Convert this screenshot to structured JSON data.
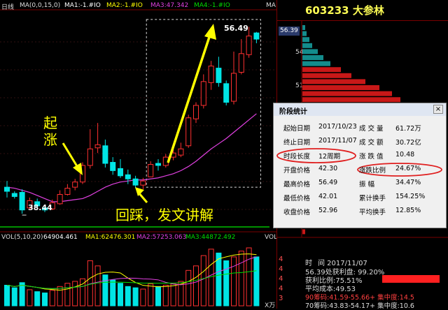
{
  "header": {
    "period": "日线",
    "ma_text": "MA(0,0,15,0)",
    "ma1": "MA1:-1.#IO",
    "ma2": "MA2:-1.#IO",
    "ma3": "MA3:47.342",
    "ma4": "MA4:-1.#IO",
    "corner": "MA"
  },
  "price_annotations": {
    "high": "56.49",
    "low": "38.44"
  },
  "annotations": {
    "qi": "起",
    "zhang": "涨",
    "huicai": "回踩，发文讲解"
  },
  "volume_header": {
    "vol": "VOL(5,10,20)",
    "vol_value": "64904.461",
    "ma1": "MA1:62476.301",
    "ma2": "MA2:57253.063",
    "ma3": "MA3:44872.492",
    "corner": "VOL",
    "unit": "X万"
  },
  "right_panel": {
    "stock_title": "603233  大参林",
    "price_box": "56.39",
    "y_labels": [
      "54",
      "51"
    ]
  },
  "dialog": {
    "title": "阶段统计",
    "close": "×",
    "rows": [
      {
        "k1": "起始日期",
        "v1": "2017/10/23",
        "k2": "成 交 量",
        "v2": "61.72万"
      },
      {
        "k1": "终止日期",
        "v1": "2017/11/07",
        "k2": "成 交 额",
        "v2": "30.72亿"
      },
      {
        "k1": "时段长度",
        "v1": "12周期",
        "k2": "涨 跌 值",
        "v2": "10.48"
      },
      {
        "k1": "开盘价格",
        "v1": "42.30",
        "k2": "涨跌比例",
        "v2": "24.67%"
      },
      {
        "k1": "最高价格",
        "v1": "56.49",
        "k2": "振    幅",
        "v2": "34.47%"
      },
      {
        "k1": "最低价格",
        "v1": "42.01",
        "k2": "累计换手",
        "v2": "154.25%"
      },
      {
        "k1": "收盘价格",
        "v1": "52.96",
        "k2": "平均换手",
        "v2": "12.85%"
      }
    ]
  },
  "info_panel": {
    "time_label": "时",
    "time_value": "间  2017/11/07",
    "line1": "56.39处获利盘: 99.20%",
    "line2": "获利比例:75.51%",
    "line3": "平均成本:49.53",
    "line4": "90筹码:41.59-55.66+ 集中度:14.5",
    "line5": "70筹码:43.83-54.17+ 集中度:10.6",
    "side_labels": [
      "4",
      "4",
      "4",
      "4",
      "3"
    ]
  },
  "colors": {
    "up": "#ff3030",
    "down": "#00e5e5",
    "ma": "#e040e0",
    "annotation": "#ffff00",
    "grid": "#7a0000"
  },
  "chart_data": {
    "type": "candlestick",
    "candles": [
      {
        "o": 41.0,
        "c": 40.6,
        "h": 41.6,
        "l": 40.0
      },
      {
        "o": 40.4,
        "c": 40.1,
        "h": 40.6,
        "l": 39.9
      },
      {
        "o": 40.5,
        "c": 38.8,
        "h": 40.8,
        "l": 38.44
      },
      {
        "o": 39.0,
        "c": 39.7,
        "h": 40.0,
        "l": 38.9
      },
      {
        "o": 39.6,
        "c": 39.2,
        "h": 39.9,
        "l": 39.0
      },
      {
        "o": 39.0,
        "c": 38.8,
        "h": 39.3,
        "l": 38.6
      },
      {
        "o": 38.9,
        "c": 39.5,
        "h": 39.8,
        "l": 38.8
      },
      {
        "o": 39.4,
        "c": 40.3,
        "h": 40.7,
        "l": 39.3
      },
      {
        "o": 40.3,
        "c": 40.9,
        "h": 41.3,
        "l": 40.2
      },
      {
        "o": 41.0,
        "c": 41.5,
        "h": 41.8,
        "l": 40.7
      },
      {
        "o": 41.5,
        "c": 43.1,
        "h": 43.4,
        "l": 41.3
      },
      {
        "o": 43.1,
        "c": 44.7,
        "h": 46.6,
        "l": 42.8
      },
      {
        "o": 44.8,
        "c": 45.1,
        "h": 47.2,
        "l": 44.3
      },
      {
        "o": 45.0,
        "c": 43.3,
        "h": 45.6,
        "l": 42.9
      },
      {
        "o": 43.4,
        "c": 42.6,
        "h": 43.9,
        "l": 42.2
      },
      {
        "o": 42.8,
        "c": 42.1,
        "h": 43.7,
        "l": 41.9
      },
      {
        "o": 42.2,
        "c": 41.8,
        "h": 42.7,
        "l": 41.3
      },
      {
        "o": 41.8,
        "c": 41.2,
        "h": 42.1,
        "l": 40.9
      },
      {
        "o": 41.2,
        "c": 41.6,
        "h": 41.9,
        "l": 40.8
      },
      {
        "o": 42.0,
        "c": 43.2,
        "h": 43.5,
        "l": 42.0
      },
      {
        "o": 43.3,
        "c": 43.1,
        "h": 43.7,
        "l": 42.6
      },
      {
        "o": 43.1,
        "c": 43.9,
        "h": 44.2,
        "l": 42.9
      },
      {
        "o": 43.9,
        "c": 44.3,
        "h": 45.0,
        "l": 43.6
      },
      {
        "o": 44.1,
        "c": 44.7,
        "h": 45.3,
        "l": 43.9
      },
      {
        "o": 45.0,
        "c": 47.7,
        "h": 48.0,
        "l": 44.8
      },
      {
        "o": 47.6,
        "c": 48.9,
        "h": 49.2,
        "l": 47.2
      },
      {
        "o": 48.9,
        "c": 51.2,
        "h": 51.9,
        "l": 48.6
      },
      {
        "o": 51.1,
        "c": 52.7,
        "h": 53.2,
        "l": 50.4
      },
      {
        "o": 52.5,
        "c": 51.1,
        "h": 53.6,
        "l": 50.7
      },
      {
        "o": 51.0,
        "c": 49.2,
        "h": 51.3,
        "l": 48.9
      },
      {
        "o": 49.3,
        "c": 52.0,
        "h": 54.1,
        "l": 49.0
      },
      {
        "o": 52.1,
        "c": 53.9,
        "h": 55.3,
        "l": 51.9
      },
      {
        "o": 53.8,
        "c": 55.6,
        "h": 56.49,
        "l": 53.5
      },
      {
        "o": 55.9,
        "c": 55.3,
        "h": 56.0,
        "l": 54.9
      }
    ],
    "ma_line": [
      41.0,
      40.9,
      40.7,
      40.5,
      40.2,
      39.9,
      39.6,
      39.6,
      39.7,
      39.8,
      39.9,
      40.2,
      40.6,
      41.0,
      41.3,
      41.5,
      41.6,
      41.7,
      41.7,
      41.8,
      41.9,
      42.1,
      42.3,
      42.6,
      43.0,
      43.5,
      44.1,
      44.7,
      45.2,
      45.7,
      46.3,
      46.9,
      47.5,
      48.1
    ],
    "volume": [
      32,
      28,
      36,
      25,
      22,
      20,
      24,
      30,
      35,
      38,
      42,
      70,
      62,
      48,
      40,
      35,
      30,
      28,
      26,
      34,
      30,
      32,
      34,
      38,
      55,
      62,
      78,
      88,
      82,
      70,
      76,
      85,
      90,
      76
    ],
    "ylim": [
      37.5,
      58.0
    ]
  }
}
